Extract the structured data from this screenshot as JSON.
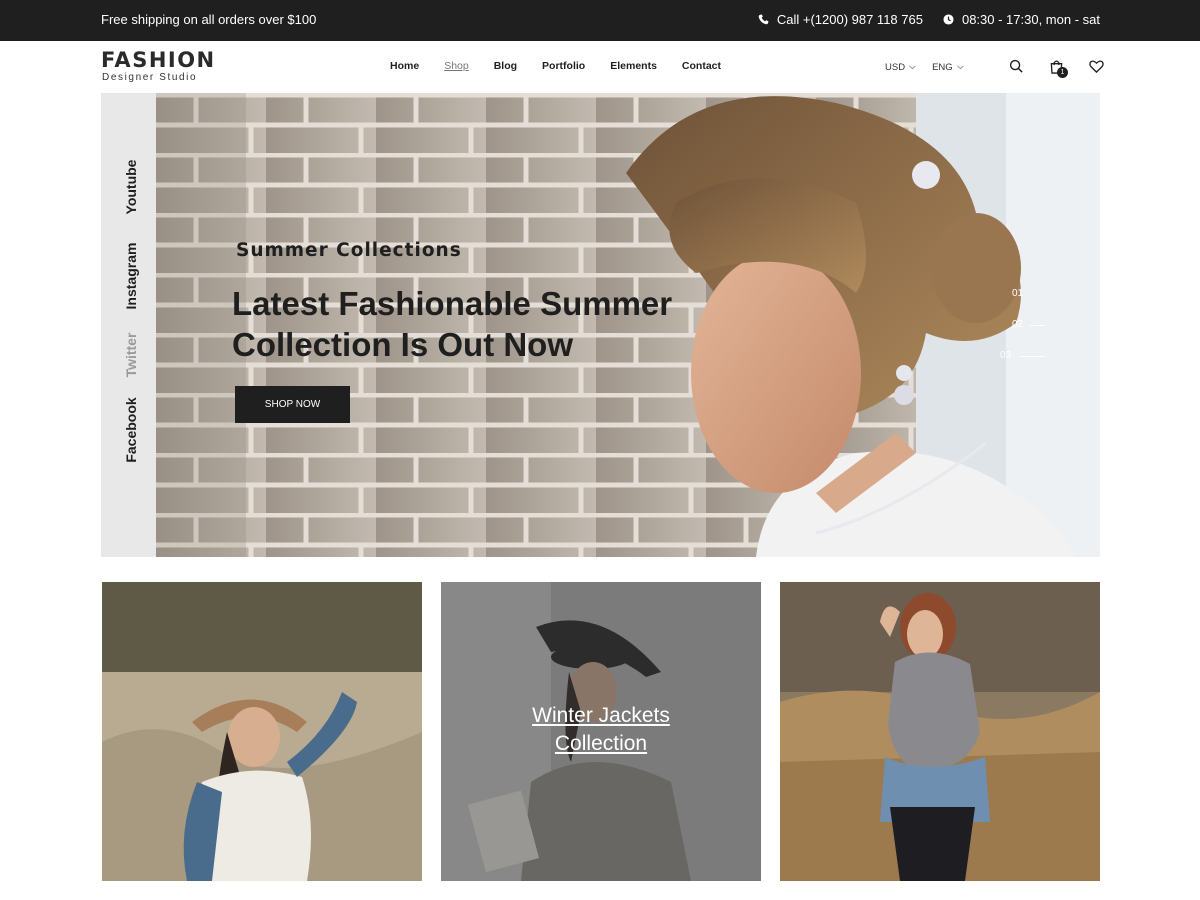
{
  "topbar": {
    "shipping_text": "Free shipping on all orders over $100",
    "phone_text": "Call +(1200) 987 118 765",
    "hours_text": "08:30 - 17:30, mon - sat"
  },
  "header": {
    "logo_title": "FASHION",
    "logo_subtitle": "Designer Studio",
    "nav": [
      "Home",
      "Shop",
      "Blog",
      "Portfolio",
      "Elements",
      "Contact"
    ],
    "active_nav": "Shop",
    "currency": "USD",
    "language": "ENG",
    "cart_count": "1"
  },
  "social": [
    "Youtube",
    "Instagram",
    "Twitter",
    "Facebook"
  ],
  "hero": {
    "eyebrow": "Summer Collections",
    "headline_line1": "Latest Fashionable Summer",
    "headline_line2": "Collection Is Out Now",
    "button_label": "SHOP NOW",
    "slides": [
      "01",
      "02",
      "03"
    ]
  },
  "collections": {
    "featured_title_line1": "Winter Jackets",
    "featured_title_line2": "Collection"
  },
  "icons": [
    "phone-icon",
    "clock-icon",
    "search-icon",
    "cart-icon",
    "heart-icon",
    "chevron-down-icon"
  ],
  "colors": {
    "dark": "#1f1f1f",
    "strip": "#e8e8e8",
    "white": "#ffffff"
  }
}
